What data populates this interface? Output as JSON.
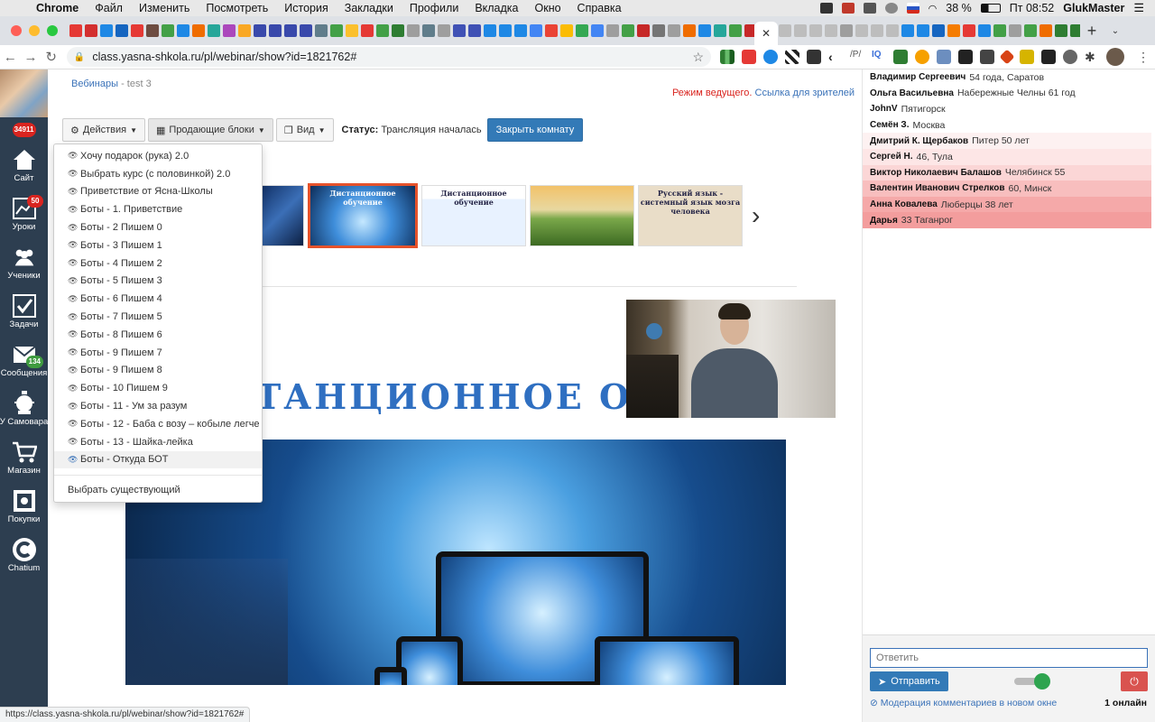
{
  "menubar": {
    "app": "Chrome",
    "items": [
      "Файл",
      "Изменить",
      "Посмотреть",
      "История",
      "Закладки",
      "Профили",
      "Вкладка",
      "Окно",
      "Справка"
    ],
    "battery": "38 %",
    "clock": "Пт 08:52",
    "user": "GlukMaster"
  },
  "browser": {
    "url": "class.yasna-shkola.ru/pl/webinar/show?id=1821762#",
    "hover_url": "https://class.yasna-shkola.ru/pl/webinar/show?id=1821762#"
  },
  "sidebar": {
    "counter": "34911",
    "items": [
      {
        "label": "Сайт",
        "icon": "home-icon"
      },
      {
        "label": "Уроки",
        "icon": "chart-icon",
        "badge": "50",
        "badge_color": "#d9241f"
      },
      {
        "label": "Ученики",
        "icon": "users-icon"
      },
      {
        "label": "Задачи",
        "icon": "checkbox-icon"
      },
      {
        "label": "Сообщения",
        "icon": "envelope-icon",
        "badge": "134",
        "badge_color": "#3f9b3f"
      },
      {
        "label": "У Самовара",
        "icon": "samovar-icon"
      },
      {
        "label": "Магазин",
        "icon": "cart-icon"
      },
      {
        "label": "Покупки",
        "icon": "safe-icon"
      },
      {
        "label": "Chatium",
        "icon": "chatium-icon"
      }
    ]
  },
  "breadcrumb": {
    "link": "Вебинары",
    "sep": "-",
    "current": "test 3"
  },
  "host_mode": {
    "text": "Режим ведущего.",
    "link": "Ссылка для зрителей"
  },
  "toolbar": {
    "actions": "Действия",
    "blocks": "Продающие блоки",
    "view": "Вид",
    "status_label": "Статус:",
    "status_value": "Трансляция началась",
    "close_room": "Закрыть комнату"
  },
  "menu": {
    "items": [
      "Хочу подарок (рука) 2.0",
      "Выбрать курс (с половинкой) 2.0",
      "Приветствие от Ясна-Школы",
      "Боты - 1. Приветствие",
      "Боты - 2 Пишем 0",
      "Боты - 3 Пишем 1",
      "Боты - 4 Пишем 2",
      "Боты - 5 Пишем 3",
      "Боты - 6 Пишем 4",
      "Боты - 7 Пишем 5",
      "Боты - 8 Пишем 6",
      "Боты - 9 Пишем 7",
      "Боты - 9 Пишем 8",
      "Боты - 10 Пишем 9",
      "Боты - 11 - Ум за разум",
      "Боты - 12 - Баба с возу – кобыле легче",
      "Боты - 13 - Шайка-лейка",
      "Боты - Откуда БОТ"
    ],
    "active_index": 17,
    "choose_existing": "Выбрать существующий"
  },
  "thumbnails": {
    "captions": [
      "Дистанционное обучение",
      "Дистанционное обучение",
      "Русский язык - системный язык мозга человека"
    ]
  },
  "slide": {
    "title": "ТАНЦИОННОЕ ОБУЧ"
  },
  "chat": {
    "messages": [
      {
        "name": "Владимир Сергеевич",
        "text": "54 года, Саратов",
        "bg": "#ffffff"
      },
      {
        "name": "Ольга Васильевна",
        "text": "Набережные Челны 61 год",
        "bg": "#ffffff"
      },
      {
        "name": "JohnV",
        "text": "Пятигорск",
        "bg": "#ffffff"
      },
      {
        "name": "Семён З.",
        "text": "Москва",
        "bg": "#ffffff"
      },
      {
        "name": "Дмитрий К. Щербаков",
        "text": "Питер 50 лет",
        "bg": "#fdf1f1"
      },
      {
        "name": "Сергей Н.",
        "text": "46, Тула",
        "bg": "#fde6e6"
      },
      {
        "name": "Виктор Николаевич Балашов",
        "text": "Челябинск 55",
        "bg": "#fbd6d6"
      },
      {
        "name": "Валентин Иванович Стрелков",
        "text": "60, Минск",
        "bg": "#f8bebe"
      },
      {
        "name": "Анна Ковалева",
        "text": "Люберцы 38 лет",
        "bg": "#f5a9a9"
      },
      {
        "name": "Дарья",
        "text": "33 Таганрог",
        "bg": "#f39d9d"
      }
    ],
    "reply_placeholder": "Ответить",
    "send": "Отправить",
    "moderation": "Модерация комментариев в новом окне",
    "online": "1 онлайн"
  }
}
